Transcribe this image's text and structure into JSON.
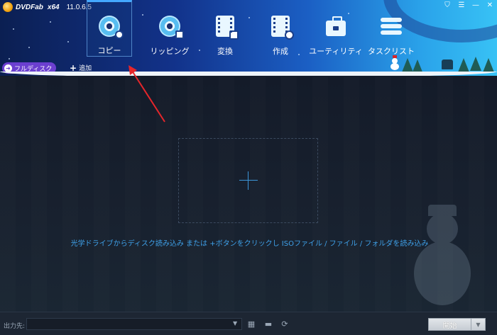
{
  "app": {
    "brand": "DVDFab",
    "arch": "x64",
    "version": "11.0.6.5"
  },
  "window_controls": {
    "shield": "⛉",
    "menu": "☰",
    "minimize": "—",
    "close": "✕"
  },
  "modules": [
    {
      "id": "copy",
      "label": "コピー",
      "icon": "disc-copy-icon",
      "active": true
    },
    {
      "id": "ripper",
      "label": "リッピング",
      "icon": "disc-ripper-icon",
      "active": false
    },
    {
      "id": "converter",
      "label": "変換",
      "icon": "film-convert-icon",
      "active": false
    },
    {
      "id": "creator",
      "label": "作成",
      "icon": "film-create-icon",
      "active": false
    },
    {
      "id": "utility",
      "label": "ユーティリティ",
      "icon": "toolbox-icon",
      "active": false
    },
    {
      "id": "tasks",
      "label": "タスクリスト",
      "icon": "task-list-icon",
      "active": false
    }
  ],
  "toolbar": {
    "full_disc_label": "フルディスク",
    "add_label": "追加"
  },
  "main": {
    "hint": "光学ドライブからディスク読み込み または +ボタンをクリックし ISOファイル / ファイル / フォルダを読み込み"
  },
  "footer": {
    "output_label": "出力先:",
    "output_value": "",
    "start_label": "開始"
  },
  "colors": {
    "accent": "#3ea0e8",
    "full_disc_bg": "#6b3fd0",
    "annotation_arrow": "#e5262b"
  }
}
